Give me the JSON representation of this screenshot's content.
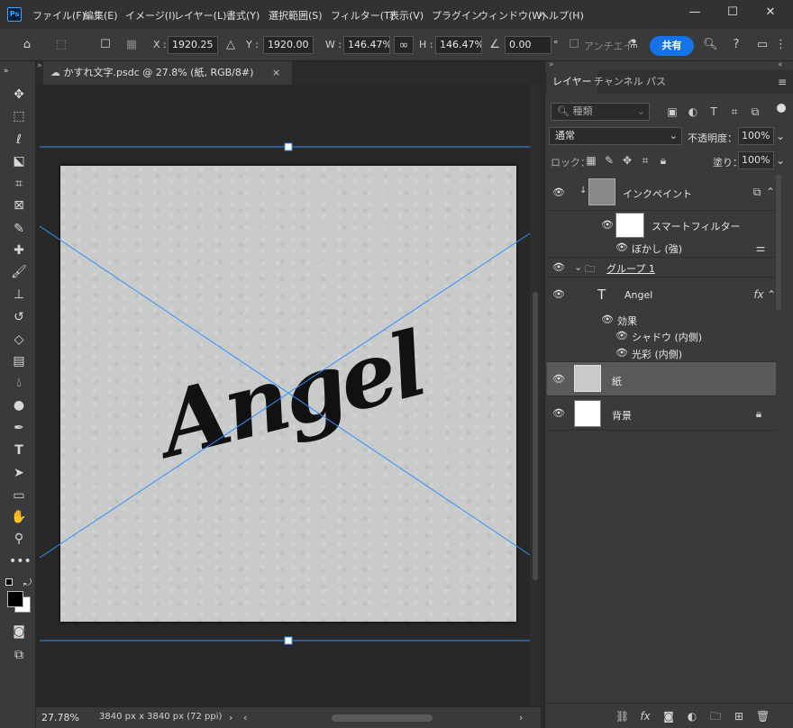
{
  "app": {
    "logo": "Ps"
  },
  "menu": [
    "ファイル(F)",
    "編集(E)",
    "イメージ(I)",
    "レイヤー(L)",
    "書式(Y)",
    "選択範囲(S)",
    "フィルター(T)",
    "表示(V)",
    "プラグイン",
    "ウィンドウ(W)",
    "ヘルプ(H)"
  ],
  "window_controls": {
    "minimize": "—",
    "maximize": "☐",
    "close": "✕"
  },
  "options": {
    "x_label": "X :",
    "x_value": "1920.25 px",
    "y_label": "Y :",
    "y_value": "1920.00 px",
    "w_label": "W :",
    "w_value": "146.47%",
    "h_label": "H :",
    "h_value": "146.47%",
    "angle_value": "0.00",
    "angle_unit": "°",
    "antialias": "アンチエイ",
    "share": "共有"
  },
  "document": {
    "tab_title": "かすれ文字.psdc @ 27.8% (紙, RGB/8#)",
    "close": "×",
    "canvas_text": "Angel",
    "zoom": "27.78%",
    "dimensions": "3840 px x 3840 px (72 ppi)"
  },
  "panel": {
    "tabs": [
      "レイヤー",
      "チャンネル",
      "パス"
    ],
    "filter_kind": "種類",
    "blend_mode": "通常",
    "opacity_label": "不透明度：",
    "opacity_value": "100%",
    "lock_label": "ロック：",
    "fill_label": "塗り：",
    "fill_value": "100%"
  },
  "layers": {
    "inkpaint": "インクペイント",
    "smart_filter": "スマートフィルター",
    "blur": "ぼかし (強)",
    "group": "グループ 1",
    "angel": "Angel",
    "effects": "効果",
    "inner_shadow": "シャドウ (内側)",
    "inner_glow": "光彩 (内側)",
    "paper": "紙",
    "background": "背景"
  },
  "colors": {
    "accent": "#1473e6",
    "guide": "#2f8fff",
    "selected_row": "#5a5a5a"
  }
}
